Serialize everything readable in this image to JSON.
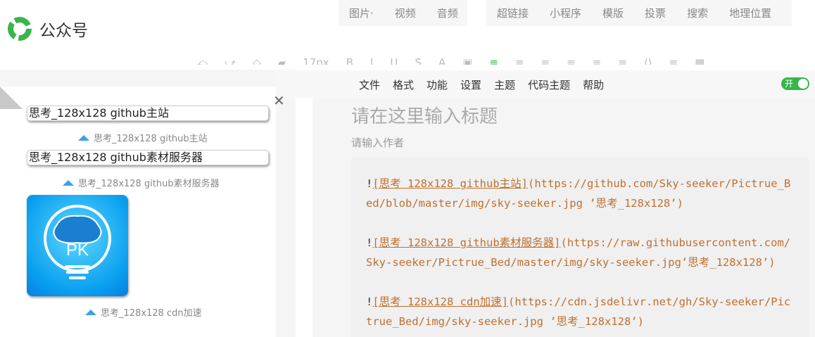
{
  "app": {
    "name": "公众号"
  },
  "top_menu_a": [
    "图片·",
    "视频",
    "音频"
  ],
  "top_menu_b": [
    "超链接",
    "小程序",
    "模版",
    "投票",
    "搜索",
    "地理位置"
  ],
  "toolbar": [
    "⤺",
    "⤻",
    "◇",
    "▰",
    "17px",
    "B",
    "I",
    "U",
    "S",
    "A",
    "▣",
    "≡",
    "≡",
    "≡",
    "≡",
    "≡",
    "≡",
    "⟨⟩",
    "≡",
    "▦"
  ],
  "menu": [
    "文件",
    "格式",
    "功能",
    "设置",
    "主题",
    "代码主题",
    "帮助"
  ],
  "switch_label": "开",
  "preview": {
    "img1_alt": "思考_128x128 github主站",
    "cap1": "思考_128x128 github主站",
    "img2_alt": "思考_128x128 github素材服务器",
    "cap2": "思考_128x128 github素材服务器",
    "pk_text": "PK",
    "cap3": "思考_128x128 cdn加速"
  },
  "editor": {
    "title_placeholder": "请在这里输入标题",
    "author_placeholder": "请输入作者",
    "lines": [
      {
        "link": "[思考 128x128 github主站]",
        "url": "(https://github.com/Sky-seeker/Pictrue_Bed/blob/master/img/sky-seeker.jpg ’思考_128x128’)"
      },
      {
        "link": "[思考 128x128 github素材服务器]",
        "url": "(https://raw.githubusercontent.com/Sky-seeker/Pictrue_Bed/master/img/sky-seeker.jpg’思考_128x128’)"
      },
      {
        "link": "[思考 128x128 cdn加速]",
        "url": "(https://cdn.jsdelivr.net/gh/Sky-seeker/Pictrue_Bed/img/sky-seeker.jpg ’思考_128x128’)"
      }
    ]
  },
  "colors": {
    "green": "#39b54a",
    "accent_blue": "#3da0e6",
    "code_orange": "#c07030"
  }
}
